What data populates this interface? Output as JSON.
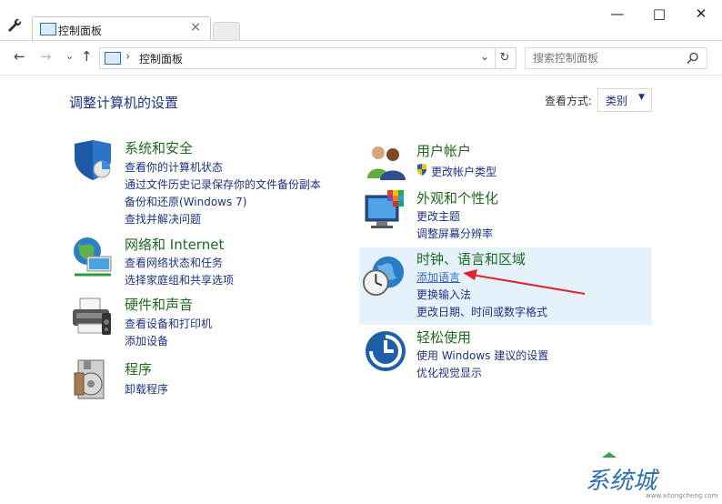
{
  "window": {
    "tab_title": "控制面板",
    "tab_close": "×",
    "minimize": "—",
    "maximize": "□",
    "close": "✕"
  },
  "address": {
    "back": "←",
    "forward": "→",
    "recent": "⌄",
    "up": "↑",
    "sep": "›",
    "path": "控制面板",
    "dropdown": "⌄",
    "refresh": "↻",
    "search_placeholder": "搜索控制面板"
  },
  "main": {
    "heading": "调整计算机的设置",
    "view_by_label": "查看方式:",
    "view_by_value": "类别",
    "view_by_arrow": "▼"
  },
  "categories_left": [
    {
      "title": "系统和安全",
      "icon": "shield-icon",
      "links": [
        "查看你的计算机状态",
        "通过文件历史记录保存你的文件备份副本",
        "备份和还原(Windows 7)",
        "查找并解决问题"
      ]
    },
    {
      "title": "网络和 Internet",
      "icon": "network-globe-icon",
      "links": [
        "查看网络状态和任务",
        "选择家庭组和共享选项"
      ]
    },
    {
      "title": "硬件和声音",
      "icon": "printer-icon",
      "links": [
        "查看设备和打印机",
        "添加设备"
      ]
    },
    {
      "title": "程序",
      "icon": "programs-icon",
      "links": [
        "卸载程序"
      ]
    }
  ],
  "categories_right": [
    {
      "title": "用户帐户",
      "icon": "users-icon",
      "links": [
        "更改帐户类型"
      ]
    },
    {
      "title": "外观和个性化",
      "icon": "monitor-palette-icon",
      "links": [
        "更改主题",
        "调整屏幕分辨率"
      ]
    },
    {
      "title": "时钟、语言和区域",
      "icon": "clock-globe-icon",
      "links": [
        "添加语言",
        "更换输入法",
        "更改日期、时间或数字格式"
      ]
    },
    {
      "title": "轻松使用",
      "icon": "ease-of-access-icon",
      "links": [
        "使用 Windows 建议的设置",
        "优化视觉显示"
      ]
    }
  ],
  "watermark": {
    "text": "系统城",
    "url": "www.xitongcheng.com"
  },
  "colors": {
    "link": "#1e3287",
    "category_title": "#1e6b1e",
    "highlight": "#e5f1fb",
    "arrow": "#e0262c"
  }
}
